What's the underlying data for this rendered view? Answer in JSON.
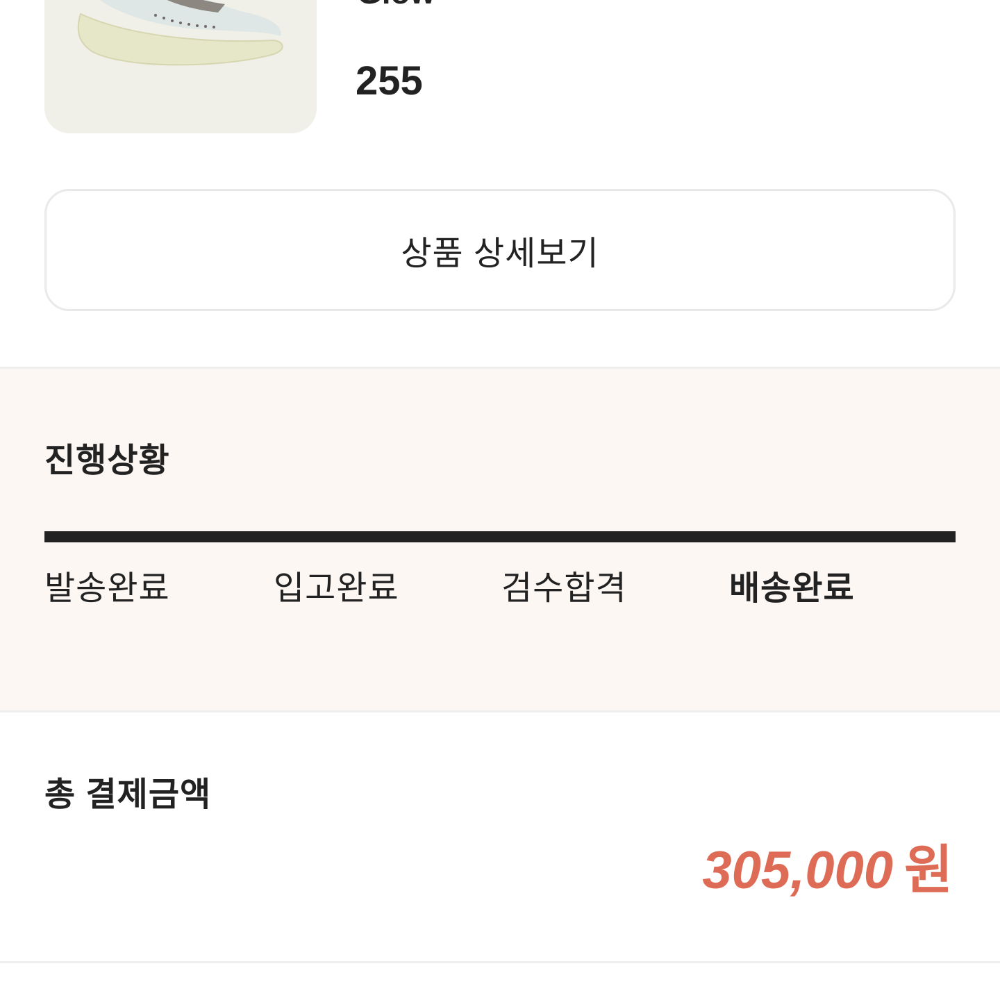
{
  "product": {
    "name_partial": "Glow",
    "size": "255",
    "image_icon": "sneaker-image",
    "detail_button_label": "상품 상세보기"
  },
  "progress": {
    "title": "진행상황",
    "fill_fraction": 1.0,
    "steps": [
      {
        "label": "발송완료"
      },
      {
        "label": "입고완료"
      },
      {
        "label": "검수합격"
      },
      {
        "label": "배송완료"
      }
    ],
    "current_step": "배송완료"
  },
  "payment": {
    "title": "총 결제금액",
    "amount": "305,000",
    "currency": "원",
    "accent_color": "#de6b55"
  }
}
